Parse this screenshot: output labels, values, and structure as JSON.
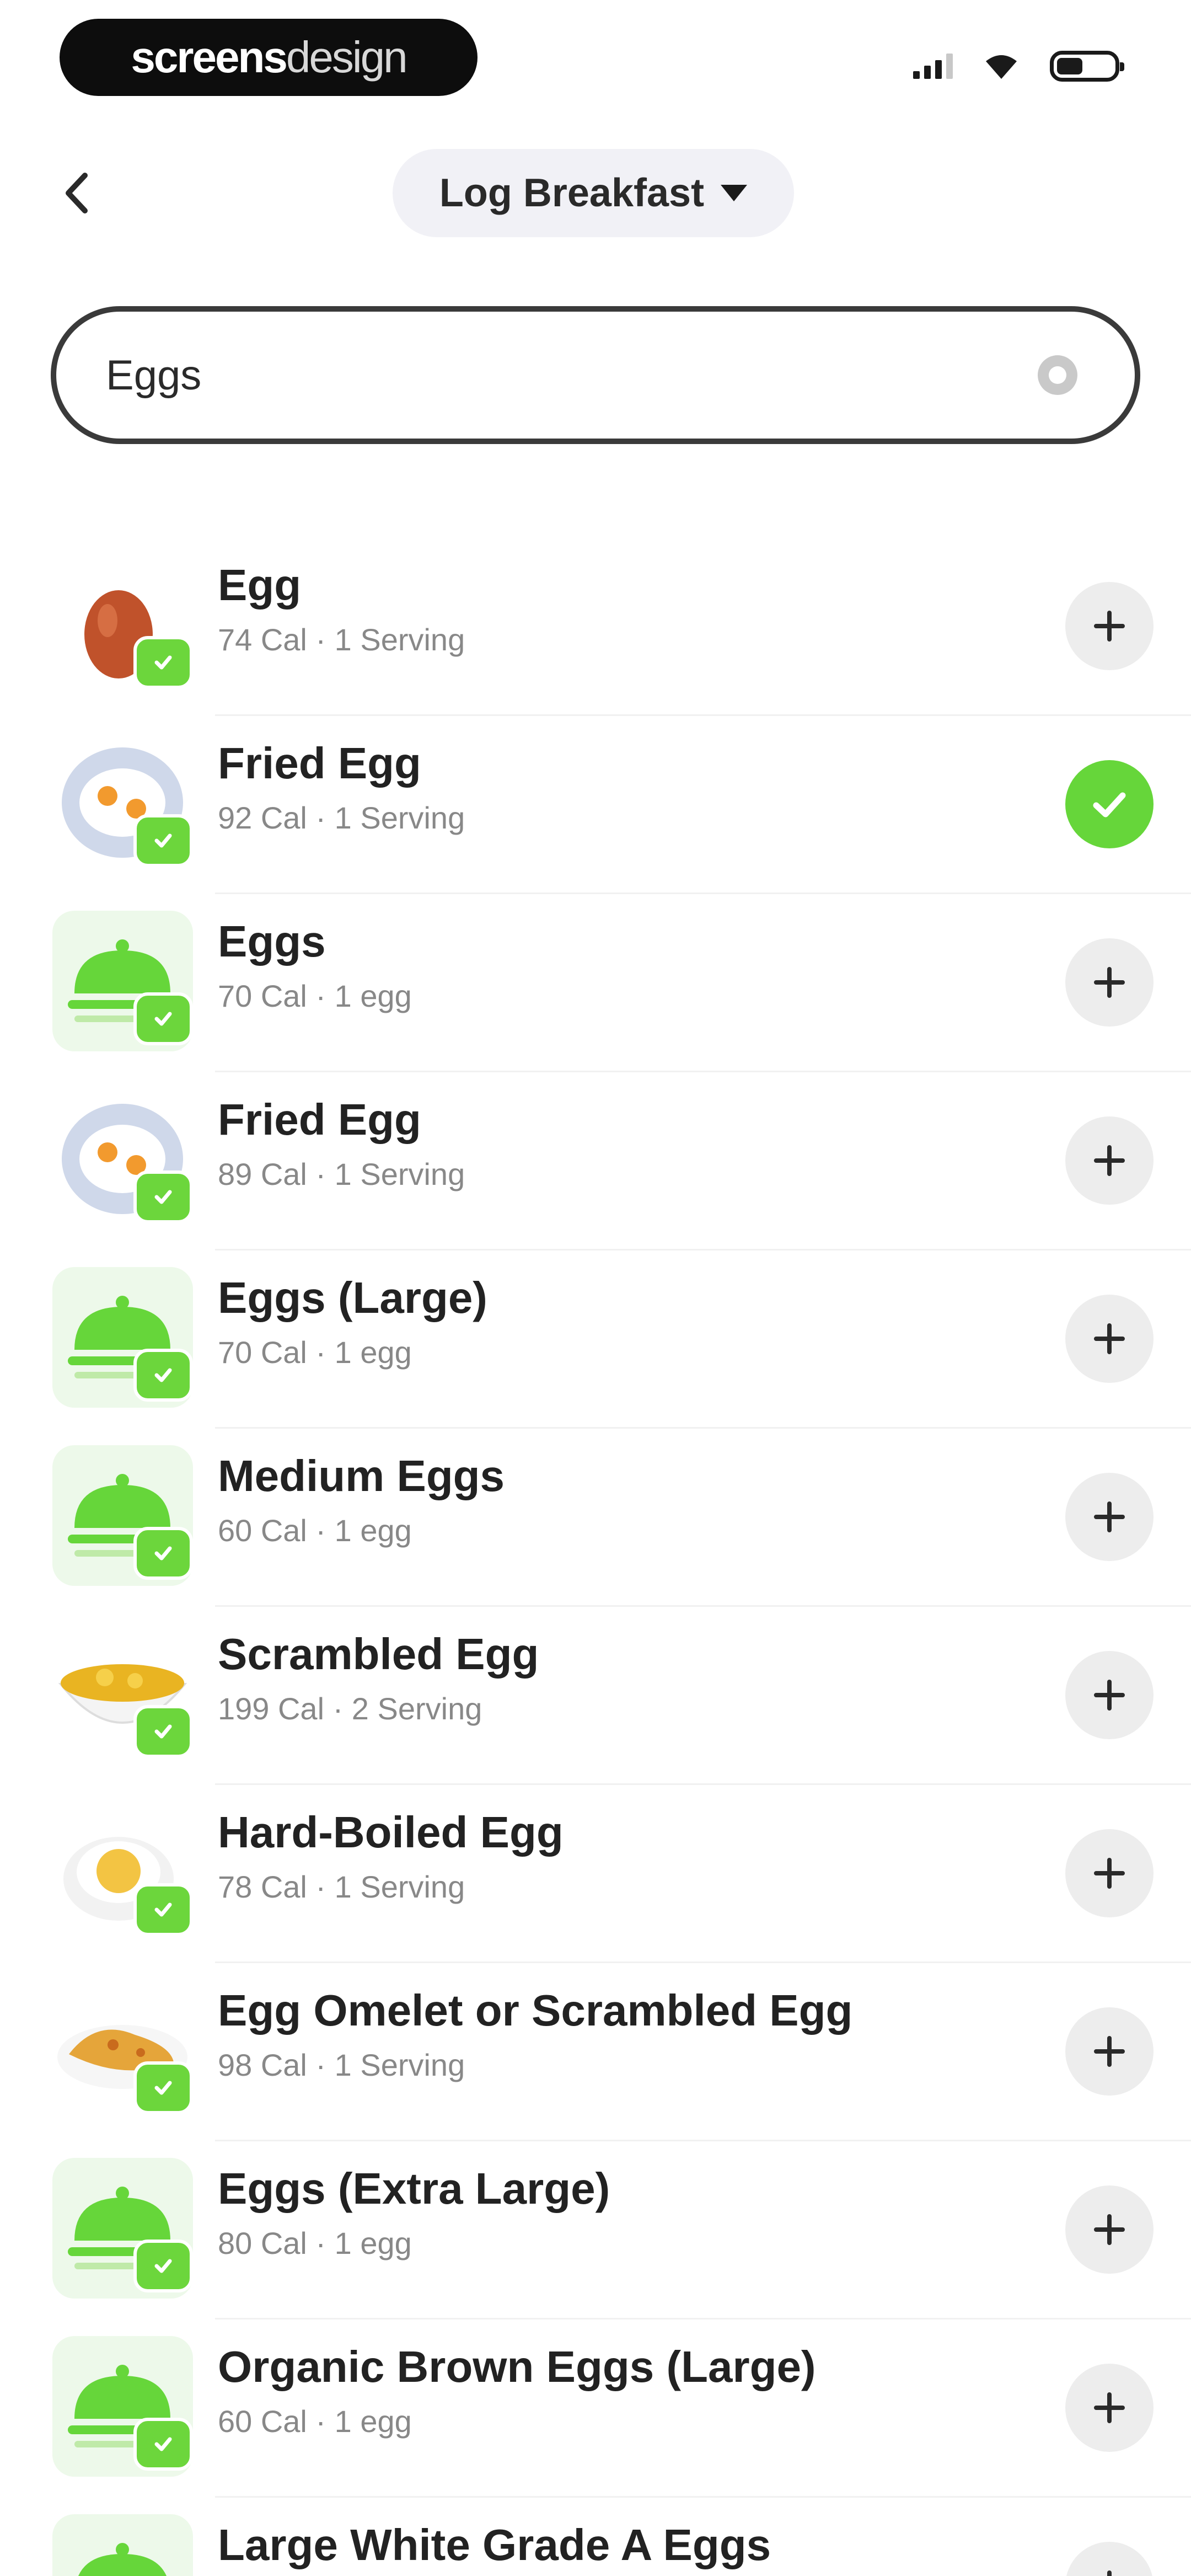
{
  "status_bar": {
    "brand_main": "screens",
    "brand_rest": "design"
  },
  "header": {
    "meal_title": "Log Breakfast"
  },
  "search": {
    "value": "Eggs"
  },
  "colors": {
    "accent_green": "#66d63a",
    "thumb_bg": "#edf9ea",
    "add_bg": "#ededed"
  },
  "items": [
    {
      "name": "Egg",
      "meta": "74 Cal · 1 Serving",
      "image": "whole-egg-icon",
      "selected": false
    },
    {
      "name": "Fried Egg",
      "meta": "92 Cal · 1 Serving",
      "image": "fried-egg-icon",
      "selected": true
    },
    {
      "name": "Eggs",
      "meta": "70 Cal · 1 egg",
      "image": "food-cloche-icon",
      "selected": false
    },
    {
      "name": "Fried Egg",
      "meta": "89 Cal · 1 Serving",
      "image": "fried-egg-icon",
      "selected": false
    },
    {
      "name": "Eggs (Large)",
      "meta": "70 Cal · 1 egg",
      "image": "food-cloche-icon",
      "selected": false
    },
    {
      "name": "Medium Eggs",
      "meta": "60 Cal · 1 egg",
      "image": "food-cloche-icon",
      "selected": false
    },
    {
      "name": "Scrambled Egg",
      "meta": "199 Cal · 2 Serving",
      "image": "scrambled-egg-icon",
      "selected": false
    },
    {
      "name": "Hard-Boiled Egg",
      "meta": "78 Cal · 1 Serving",
      "image": "boiled-egg-icon",
      "selected": false
    },
    {
      "name": "Egg Omelet or Scrambled Egg",
      "meta": "98 Cal · 1 Serving",
      "image": "omelet-icon",
      "selected": false
    },
    {
      "name": "Eggs (Extra Large)",
      "meta": "80 Cal · 1 egg",
      "image": "food-cloche-icon",
      "selected": false
    },
    {
      "name": "Organic Brown Eggs (Large)",
      "meta": "60 Cal · 1 egg",
      "image": "food-cloche-icon",
      "selected": false
    },
    {
      "name": "Large White Grade A Eggs",
      "meta": "",
      "image": "food-cloche-icon",
      "selected": false
    }
  ]
}
